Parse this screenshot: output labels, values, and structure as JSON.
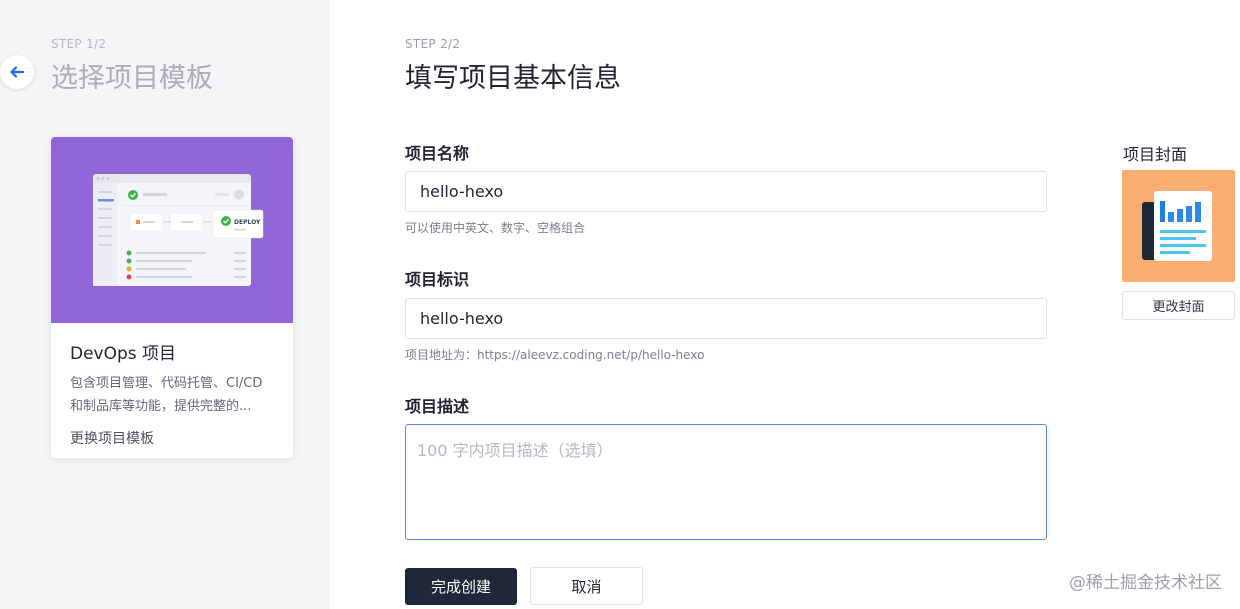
{
  "step1": {
    "label": "STEP 1/2",
    "title": "选择项目模板"
  },
  "template_card": {
    "preview_badge": "DEPLOY",
    "title": "DevOps 项目",
    "description": "包含项目管理、代码托管、CI/CD和制品库等功能，提供完整的...",
    "change_link": "更换项目模板"
  },
  "step2": {
    "label": "STEP 2/2",
    "title": "填写项目基本信息"
  },
  "form": {
    "name": {
      "label": "项目名称",
      "value": "hello-hexo",
      "hint": "可以使用中英文、数字、空格组合"
    },
    "identifier": {
      "label": "项目标识",
      "value": "hello-hexo",
      "hint": "项目地址为：https://aleevz.coding.net/p/hello-hexo"
    },
    "description": {
      "label": "项目描述",
      "value": "",
      "placeholder": "100 字内项目描述（选填）"
    }
  },
  "cover": {
    "label": "项目封面",
    "change_button": "更改封面"
  },
  "actions": {
    "submit": "完成创建",
    "cancel": "取消"
  },
  "watermark": "@稀土掘金技术社区",
  "colors": {
    "card_banner": "#9166d9",
    "cover_bg": "#fbae73",
    "primary_button": "#1f2838",
    "focus_border": "#5a8fe0",
    "back_arrow": "#1e6fe0"
  },
  "icons": {
    "back": "arrow-left-icon",
    "cover": "newspaper-chart-icon"
  }
}
